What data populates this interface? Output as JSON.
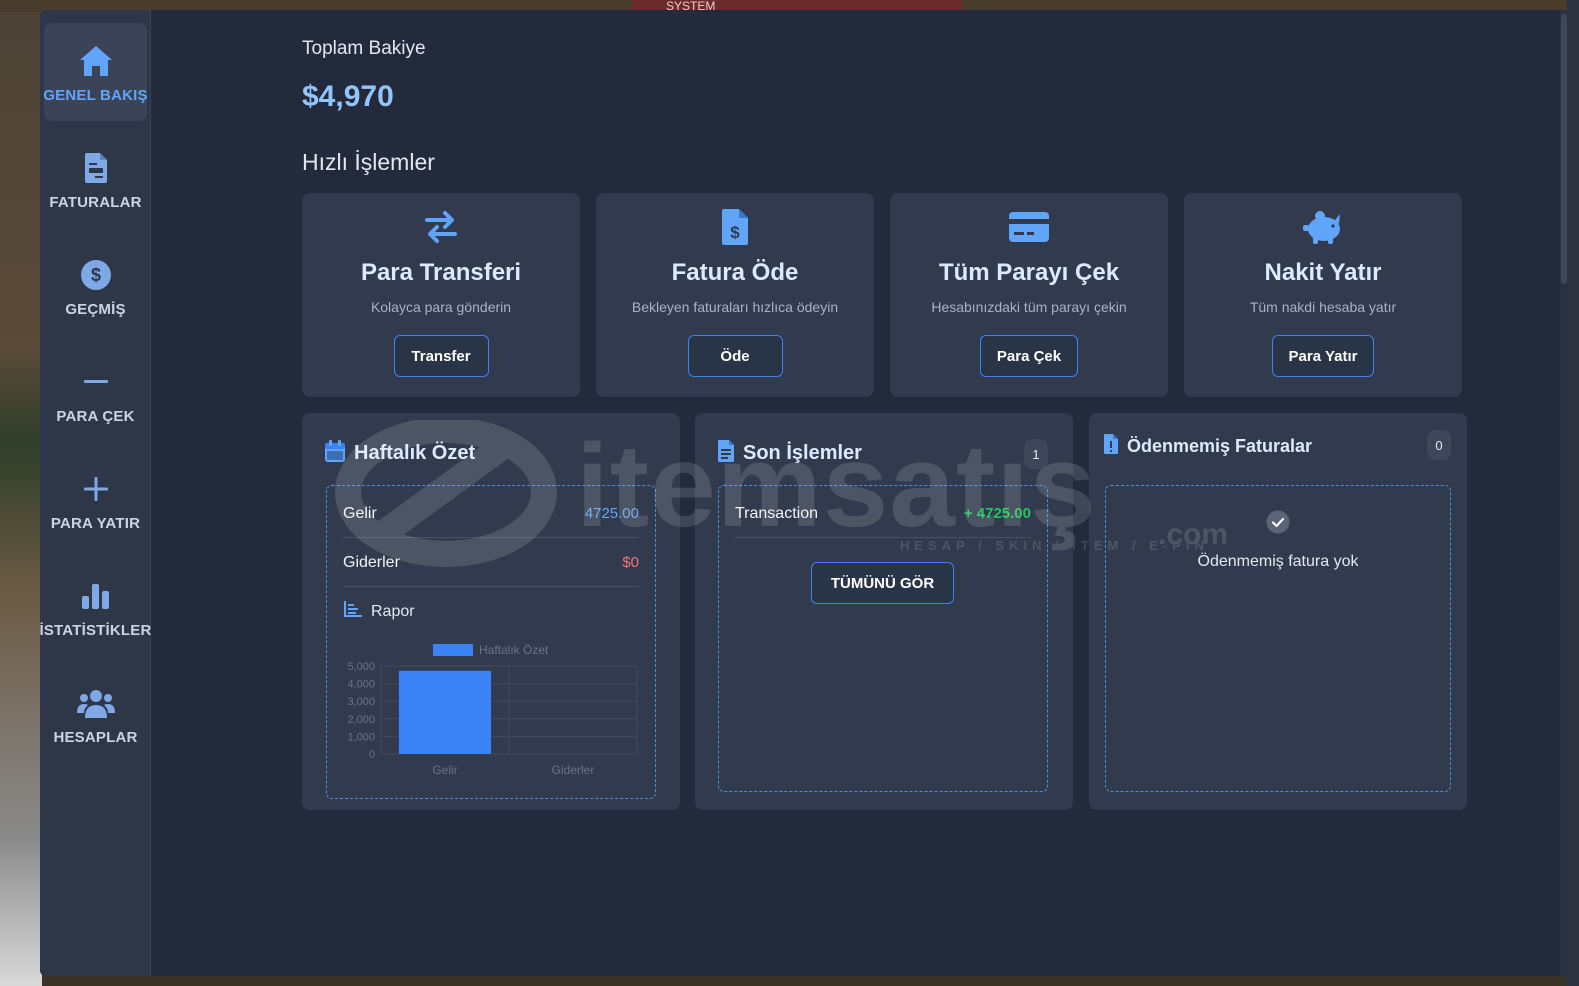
{
  "system_tab": "SYSTEM",
  "sidebar": {
    "items": [
      {
        "label": "GENEL BAKIŞ",
        "icon": "home-icon",
        "active": true
      },
      {
        "label": "FATURALAR",
        "icon": "invoice-icon"
      },
      {
        "label": "GEÇMİŞ",
        "icon": "dollar-circle-icon"
      },
      {
        "label": "PARA ÇEK",
        "icon": "minus-icon"
      },
      {
        "label": "PARA YATIR",
        "icon": "plus-icon"
      },
      {
        "label": "İSTATİSTİKLER",
        "icon": "bar-chart-icon"
      },
      {
        "label": "HESAPLAR",
        "icon": "users-icon"
      }
    ]
  },
  "balance": {
    "label": "Toplam Bakiye",
    "value": "$4,970"
  },
  "quick_actions": {
    "title": "Hızlı İşlemler",
    "cards": [
      {
        "title": "Para Transferi",
        "desc": "Kolayca para gönderin",
        "button": "Transfer",
        "icon": "transfer-arrows-icon"
      },
      {
        "title": "Fatura Öde",
        "desc": "Bekleyen faturaları hızlıca ödeyin",
        "button": "Öde",
        "icon": "invoice-dollar-icon"
      },
      {
        "title": "Tüm Parayı Çek",
        "desc": "Hesabınızdaki tüm parayı çekin",
        "button": "Para Çek",
        "icon": "credit-card-icon"
      },
      {
        "title": "Nakit Yatır",
        "desc": "Tüm nakdi hesaba yatır",
        "button": "Para Yatır",
        "icon": "piggy-bank-icon"
      }
    ]
  },
  "weekly": {
    "title": "Haftalık Özet",
    "income_label": "Gelir",
    "income_value": "4725.00",
    "expense_label": "Giderler",
    "expense_value": "$0",
    "report_label": "Rapor"
  },
  "recent": {
    "title": "Son İşlemler",
    "count": "1",
    "transactions": [
      {
        "label": "Transaction",
        "amount": "+ 4725.00"
      }
    ],
    "see_all": "TÜMÜNÜ GÖR"
  },
  "unpaid": {
    "title": "Ödenmemiş Faturalar",
    "count": "0",
    "empty_text": "Ödenmemiş fatura yok"
  },
  "watermark": {
    "brand": "itemsatış",
    "tagline": "HESAP / SKIN / ITEM / E-PIN",
    "tld": ".com"
  },
  "colors": {
    "accent": "#60a5fa",
    "bar": "#3b82f6",
    "income": "#60a5fa",
    "expense": "#f87171",
    "positive": "#22c55e"
  },
  "chart_data": {
    "type": "bar",
    "categories": [
      "Gelir",
      "Giderler"
    ],
    "series": [
      {
        "name": "Haftalık Özet",
        "values": [
          4725,
          0
        ]
      }
    ],
    "yticks": [
      "0",
      "1,000",
      "2,000",
      "3,000",
      "4,000",
      "5,000"
    ],
    "ylim": [
      0,
      5000
    ],
    "legend": "top"
  }
}
